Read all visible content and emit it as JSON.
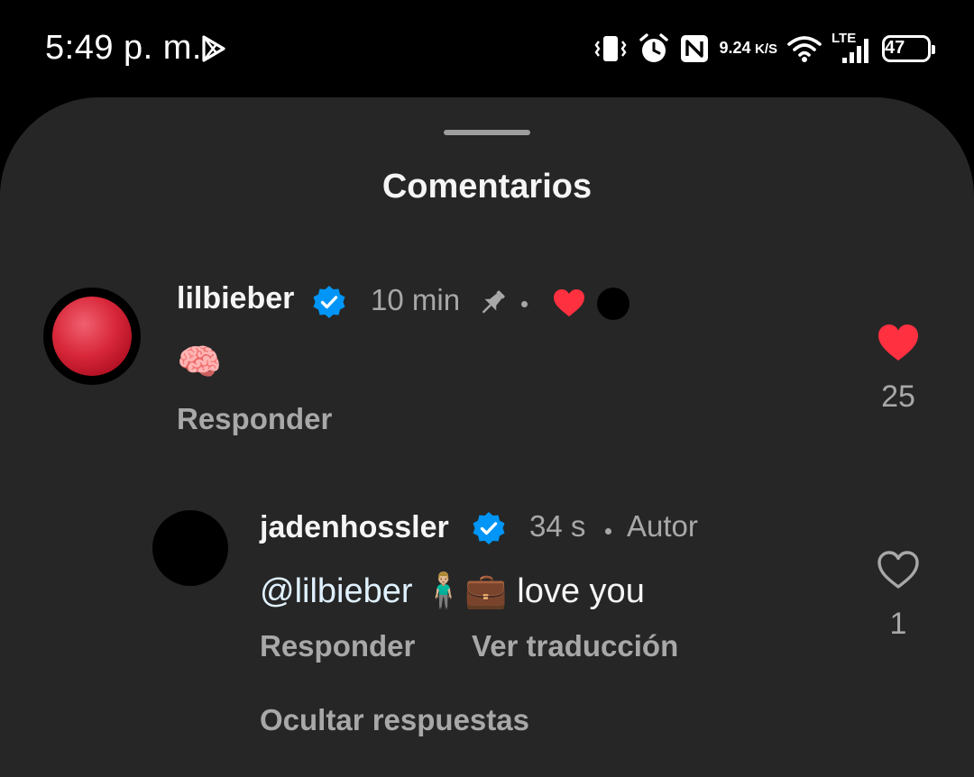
{
  "status_bar": {
    "time": "5:49 p. m.",
    "net_speed_value": "9.24",
    "net_speed_unit": "K/S",
    "network_type": "LTE",
    "battery_level": "47",
    "icons": [
      "play-store-icon",
      "vibrate-icon",
      "alarm-icon",
      "nfc-icon",
      "wifi-icon",
      "signal-icon",
      "battery-icon"
    ]
  },
  "sheet": {
    "title": "Comentarios"
  },
  "comments": [
    {
      "username": "lilbieber",
      "verified": true,
      "time": "10 min",
      "pinned": true,
      "liked_by_author": true,
      "text": "🧠",
      "reply_label": "Responder",
      "liked": true,
      "like_count": "25"
    },
    {
      "username": "jadenhossler",
      "verified": true,
      "time": "34 s",
      "author_label": "Autor",
      "mention": "@lilbieber",
      "text": " 🧍🏼‍♂️💼 love you",
      "reply_label": "Responder",
      "translate_label": "Ver traducción",
      "liked": false,
      "like_count": "1"
    }
  ],
  "hide_replies_label": "Ocultar respuestas",
  "colors": {
    "sheet_bg": "#262626",
    "secondary_text": "#a8a8a8",
    "heart_red": "#ff3040",
    "verified_blue": "#0095f6"
  }
}
